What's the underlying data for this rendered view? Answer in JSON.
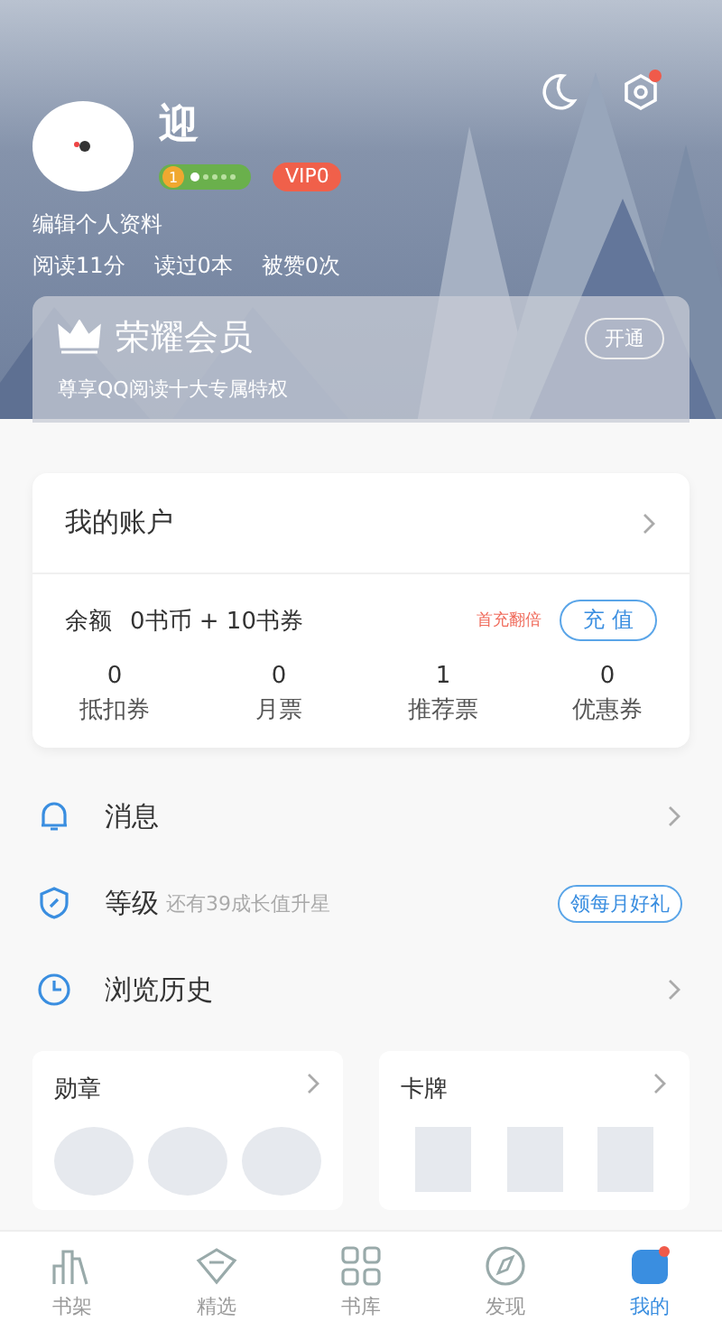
{
  "profile": {
    "name": "迎",
    "level_badge": "1",
    "vip_badge": "VIP0",
    "edit_link": "编辑个人资料",
    "stats": [
      "阅读11分",
      "读过0本",
      "被赞0次"
    ],
    "settings_notification": true
  },
  "membership": {
    "title": "荣耀会员",
    "subtitle": "尊享QQ阅读十大专属特权",
    "button": "开通"
  },
  "account": {
    "title": "我的账户",
    "balance_label": "余额",
    "balance_value": "0书币 + 10书券",
    "promo": "首充翻倍",
    "recharge_button": "充 值",
    "stats": [
      {
        "value": "0",
        "label": "抵扣券"
      },
      {
        "value": "0",
        "label": "月票"
      },
      {
        "value": "1",
        "label": "推荐票"
      },
      {
        "value": "0",
        "label": "优惠券"
      }
    ]
  },
  "menu": [
    {
      "kind": "bell",
      "label": "消息"
    },
    {
      "kind": "shield",
      "label": "等级",
      "hint": "还有39成长值升星",
      "action": "领每月好礼"
    },
    {
      "kind": "clock",
      "label": "浏览历史"
    }
  ],
  "collections": [
    {
      "kind": "badges",
      "title": "勋章"
    },
    {
      "kind": "cards",
      "title": "卡牌"
    }
  ],
  "tab_bar": [
    {
      "kind": "shelf",
      "label": "书架",
      "selected": false
    },
    {
      "kind": "gem",
      "label": "精选",
      "selected": false
    },
    {
      "kind": "grid",
      "label": "书库",
      "selected": false
    },
    {
      "kind": "compass",
      "label": "发现",
      "selected": false
    },
    {
      "kind": "me",
      "label": "我的",
      "selected": true
    }
  ]
}
